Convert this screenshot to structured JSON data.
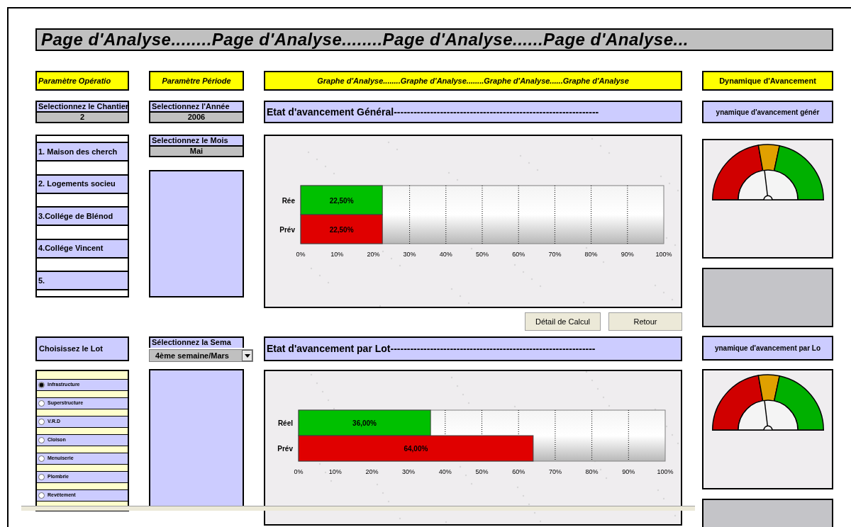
{
  "page_title": "Page d'Analyse........Page d'Analyse........Page d'Analyse......Page d'Analyse...",
  "operation": {
    "header": "Paramètre Opératio",
    "site_select": {
      "label": "Selectionnez le Chantier",
      "value": "2"
    },
    "sites": [
      {
        "label": "1. Maison des cherch"
      },
      {
        "label": "2. Logements socieu"
      },
      {
        "label": "3.Collége de Blénod"
      },
      {
        "label": "4.Collége Vincent"
      },
      {
        "label": "5."
      }
    ],
    "lot_title": "Choisissez le Lot",
    "lots": [
      {
        "label": "Infrastructure",
        "selected": true
      },
      {
        "label": "Superstructure",
        "selected": false
      },
      {
        "label": "V.R.D",
        "selected": false
      },
      {
        "label": "Cloison",
        "selected": false
      },
      {
        "label": "Menuiserie",
        "selected": false
      },
      {
        "label": "Plombrie",
        "selected": false
      },
      {
        "label": "Revêtement",
        "selected": false
      }
    ]
  },
  "period": {
    "header": "Paramètre Période",
    "year_select": {
      "label": "Selectionnez l'Année",
      "value": "2006"
    },
    "month_select": {
      "label": "Selectionnez le Mois",
      "value": "Mai"
    },
    "week_select": {
      "label": "Sélectionnez la Sema",
      "value": "4ème semaine/Mars"
    }
  },
  "analysis": {
    "header": "Graphe d'Analyse........Graphe  d'Analyse........Graphe d'Analyse......Graphe d'Analyse",
    "panels": [
      {
        "section_title": "Etat d'avancement Général--------------------------------------------------------------",
        "chart_data": {
          "type": "bar",
          "orientation": "horizontal",
          "categories": [
            "Rée",
            "Prév"
          ],
          "grid": true,
          "series": [
            {
              "color": "#00c000",
              "values": [
                22.5,
                null
              ]
            },
            {
              "color": "#e00000",
              "values": [
                null,
                22.5
              ]
            }
          ],
          "value_labels": [
            "22,50%",
            "22,50%"
          ],
          "xlim": [
            0,
            100
          ],
          "xticks": [
            {
              "value": 0,
              "label": "0%"
            },
            {
              "value": 10,
              "label": "10%"
            },
            {
              "value": 20,
              "label": "20%"
            },
            {
              "value": 30,
              "label": "30%"
            },
            {
              "value": 40,
              "label": "40%"
            },
            {
              "value": 50,
              "label": "50%"
            },
            {
              "value": 60,
              "label": "60%"
            },
            {
              "value": 70,
              "label": "70%"
            },
            {
              "value": 80,
              "label": "80%"
            },
            {
              "value": 90,
              "label": "90%"
            },
            {
              "value": 100,
              "label": "100%"
            }
          ]
        },
        "buttons": [
          "Détail de Calcul",
          "Retour"
        ]
      },
      {
        "section_title": "Etat d'avancement par Lot--------------------------------------------------------------",
        "chart_data": {
          "type": "bar",
          "orientation": "horizontal",
          "categories": [
            "Réel",
            "Prév"
          ],
          "grid": true,
          "series": [
            {
              "color": "#00c000",
              "values": [
                36,
                null
              ]
            },
            {
              "color": "#e00000",
              "values": [
                null,
                64
              ]
            }
          ],
          "value_labels": [
            "36,00%",
            "64,00%"
          ],
          "xlim": [
            0,
            100
          ],
          "xticks": [
            {
              "value": 0,
              "label": "0%"
            },
            {
              "value": 10,
              "label": "10%"
            },
            {
              "value": 20,
              "label": "20%"
            },
            {
              "value": 30,
              "label": "30%"
            },
            {
              "value": 40,
              "label": "40%"
            },
            {
              "value": 50,
              "label": "50%"
            },
            {
              "value": 60,
              "label": "60%"
            },
            {
              "value": 70,
              "label": "70%"
            },
            {
              "value": 80,
              "label": "80%"
            },
            {
              "value": 90,
              "label": "90%"
            },
            {
              "value": 100,
              "label": "100%"
            }
          ]
        }
      }
    ]
  },
  "dynamics": {
    "header": "Dynamique d'Avancement",
    "panel_titles": [
      "ynamique d'avancement génér",
      "ynamique d'avancement par Lo"
    ]
  }
}
